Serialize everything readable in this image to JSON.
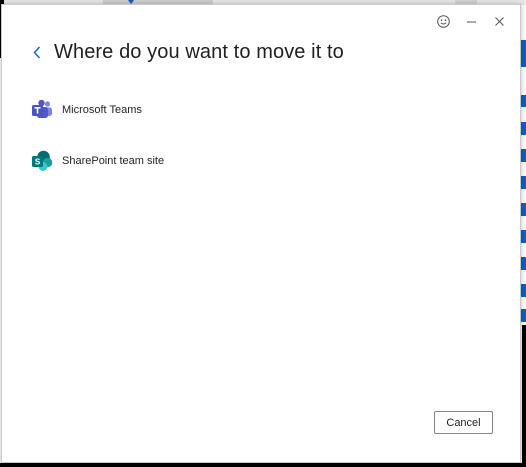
{
  "dialog": {
    "title": "Where do you want to move it to",
    "back_icon": "chevron-left-icon",
    "controls": {
      "feedback_icon": "smiley-icon",
      "minimize_icon": "minimize-icon",
      "close_icon": "close-icon"
    }
  },
  "options": [
    {
      "label": "Microsoft Teams",
      "icon": "microsoft-teams-icon"
    },
    {
      "label": "SharePoint team site",
      "icon": "sharepoint-icon"
    }
  ],
  "footer": {
    "cancel_label": "Cancel"
  },
  "colors": {
    "accent": "#0b62c1",
    "teams": "#5059c9",
    "sharepoint": "#038387"
  }
}
